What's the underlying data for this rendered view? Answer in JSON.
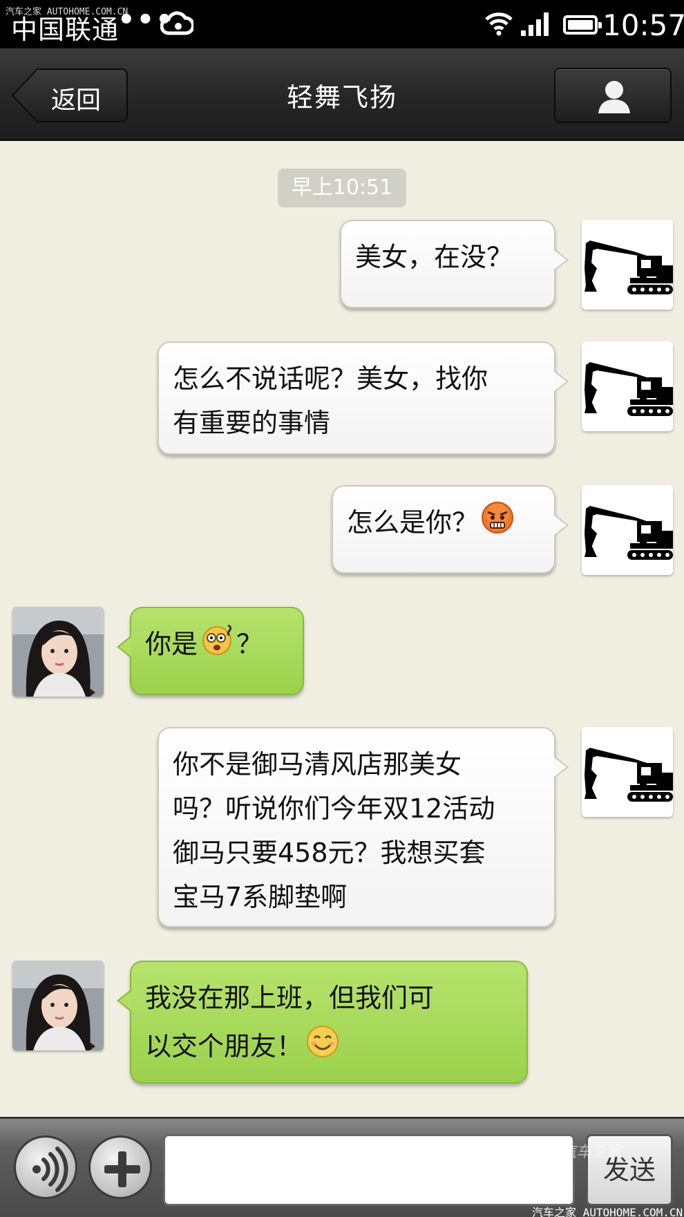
{
  "status_bar": {
    "carrier": "中国联通",
    "dots": "•••",
    "time": "10:57",
    "watermark": "汽车之家 AUTOHOME.COM.CN"
  },
  "header": {
    "back_label": "返回",
    "title": "轻舞飞扬"
  },
  "chat": {
    "timestamp": "早上10:51",
    "messages": [
      {
        "direction": "out",
        "text": "美女，在没？"
      },
      {
        "direction": "out",
        "lines": [
          "怎么不说话呢？美女，找你",
          "有重要的事情"
        ]
      },
      {
        "direction": "out",
        "text": "怎么是你？",
        "emoji": "angry-face-icon"
      },
      {
        "direction": "in",
        "text_before": "你是",
        "emoji": "dizzy-face-icon",
        "text_after": "？"
      },
      {
        "direction": "out",
        "lines": [
          "你不是御马清风店那美女",
          "吗？听说你们今年双12活动",
          "御马只要458元？我想买套",
          "宝马7系脚垫啊"
        ]
      },
      {
        "direction": "in",
        "lines": [
          "我没在那上班，但我们可",
          "以交个朋友！"
        ],
        "emoji": "smile-face-icon"
      }
    ]
  },
  "input_bar": {
    "input_value": "",
    "send_label": "发送",
    "watermark_logo": "汽车之家",
    "watermark_bottom": "汽车之家 AUTOHOME.COM.CN"
  },
  "icons": {
    "voice": "voice-icon",
    "plus": "plus-icon",
    "profile": "person-icon",
    "back": "back-arrow-icon",
    "cloud": "cloud-icon",
    "wifi": "wifi-icon",
    "signal": "signal-icon",
    "battery": "battery-icon"
  },
  "colors": {
    "chat_background": "#efeee0",
    "incoming_bubble": "#a8dc58",
    "outgoing_bubble": "#ffffff",
    "header": "#262626"
  }
}
